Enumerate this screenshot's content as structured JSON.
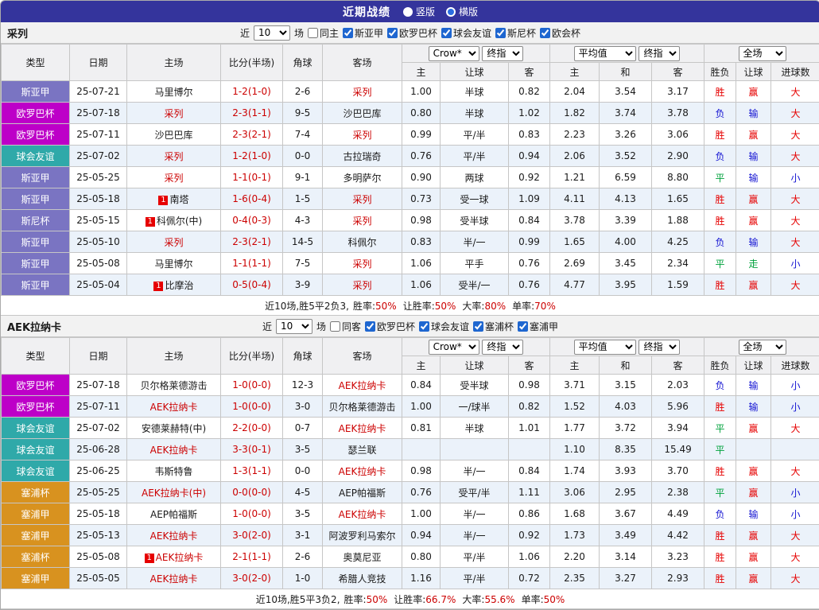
{
  "titlebar": {
    "title": "近期战绩",
    "layout_options": [
      {
        "label": "竖版",
        "selected": false
      },
      {
        "label": "横版",
        "selected": true
      }
    ]
  },
  "table_header": {
    "col_type": "类型",
    "col_date": "日期",
    "col_home": "主场",
    "col_score": "比分(半场)",
    "col_corner": "角球",
    "col_away": "客场",
    "odds_select_company": "Crow*",
    "odds_select_time": "终指",
    "odds_col_home": "主",
    "odds_col_handicap": "让球",
    "odds_col_away": "客",
    "avg_select": "平均值",
    "avg_select_time": "终指",
    "avg_col_home": "主",
    "avg_col_draw": "和",
    "avg_col_away": "客",
    "full_select": "全场",
    "full_col_result": "胜负",
    "full_col_handicap": "让球",
    "full_col_goals": "进球数"
  },
  "league_colors": {
    "斯亚甲": "#7a74c2",
    "欧罗巴杯": "#bd00c8",
    "球会友谊": "#2fa9a9",
    "斯尼杯": "#7a74c2",
    "塞浦杯": "#d8921f",
    "塞浦甲": "#d8921f"
  },
  "result_colors": {
    "胜": "#e60000",
    "负": "#1414d2",
    "平": "#00a23c",
    "赢": "#e60000",
    "输": "#1414d2",
    "走": "#00a23c",
    "大": "#e60000",
    "小": "#1414d2"
  },
  "sections": [
    {
      "team": "采列",
      "filter": {
        "near_label": "近",
        "count": "10",
        "games_label": "场",
        "venue": {
          "label": "同主",
          "checked": false
        },
        "leagues": [
          {
            "label": "斯亚甲",
            "checked": true
          },
          {
            "label": "欧罗巴杯",
            "checked": true
          },
          {
            "label": "球会友谊",
            "checked": true
          },
          {
            "label": "斯尼杯",
            "checked": true
          },
          {
            "label": "欧会杯",
            "checked": true
          }
        ]
      },
      "rows": [
        {
          "league": "斯亚甲",
          "date": "25-07-21",
          "home": {
            "name": "马里博尔",
            "focus": false,
            "badge": ""
          },
          "score": "1-2(1-0)",
          "corner": "2-6",
          "away": {
            "name": "采列",
            "focus": true,
            "badge": ""
          },
          "odds": [
            "1.00",
            "半球",
            "0.82"
          ],
          "avg": [
            "2.04",
            "3.54",
            "3.17"
          ],
          "outcome": [
            "胜",
            "赢",
            "大"
          ]
        },
        {
          "league": "欧罗巴杯",
          "date": "25-07-18",
          "home": {
            "name": "采列",
            "focus": true,
            "badge": ""
          },
          "score": "2-3(1-1)",
          "corner": "9-5",
          "away": {
            "name": "沙巴巴库",
            "focus": false,
            "badge": ""
          },
          "odds": [
            "0.80",
            "半球",
            "1.02"
          ],
          "avg": [
            "1.82",
            "3.74",
            "3.78"
          ],
          "outcome": [
            "负",
            "输",
            "大"
          ]
        },
        {
          "league": "欧罗巴杯",
          "date": "25-07-11",
          "home": {
            "name": "沙巴巴库",
            "focus": false,
            "badge": ""
          },
          "score": "2-3(2-1)",
          "corner": "7-4",
          "away": {
            "name": "采列",
            "focus": true,
            "badge": ""
          },
          "odds": [
            "0.99",
            "平/半",
            "0.83"
          ],
          "avg": [
            "2.23",
            "3.26",
            "3.06"
          ],
          "outcome": [
            "胜",
            "赢",
            "大"
          ]
        },
        {
          "league": "球会友谊",
          "date": "25-07-02",
          "home": {
            "name": "采列",
            "focus": true,
            "badge": ""
          },
          "score": "1-2(1-0)",
          "corner": "0-0",
          "away": {
            "name": "古拉瑞奇",
            "focus": false,
            "badge": ""
          },
          "odds": [
            "0.76",
            "平/半",
            "0.94"
          ],
          "avg": [
            "2.06",
            "3.52",
            "2.90"
          ],
          "outcome": [
            "负",
            "输",
            "大"
          ]
        },
        {
          "league": "斯亚甲",
          "date": "25-05-25",
          "home": {
            "name": "采列",
            "focus": true,
            "badge": ""
          },
          "score": "1-1(0-1)",
          "corner": "9-1",
          "away": {
            "name": "多明萨尔",
            "focus": false,
            "badge": ""
          },
          "odds": [
            "0.90",
            "两球",
            "0.92"
          ],
          "avg": [
            "1.21",
            "6.59",
            "8.80"
          ],
          "outcome": [
            "平",
            "输",
            "小"
          ]
        },
        {
          "league": "斯亚甲",
          "date": "25-05-18",
          "home": {
            "name": "南塔",
            "focus": false,
            "badge": "1"
          },
          "score": "1-6(0-4)",
          "corner": "1-5",
          "away": {
            "name": "采列",
            "focus": true,
            "badge": ""
          },
          "odds": [
            "0.73",
            "受一球",
            "1.09"
          ],
          "avg": [
            "4.11",
            "4.13",
            "1.65"
          ],
          "outcome": [
            "胜",
            "赢",
            "大"
          ]
        },
        {
          "league": "斯尼杯",
          "date": "25-05-15",
          "home": {
            "name": "科佩尔(中)",
            "focus": false,
            "badge": "1"
          },
          "score": "0-4(0-3)",
          "corner": "4-3",
          "away": {
            "name": "采列",
            "focus": true,
            "badge": ""
          },
          "odds": [
            "0.98",
            "受半球",
            "0.84"
          ],
          "avg": [
            "3.78",
            "3.39",
            "1.88"
          ],
          "outcome": [
            "胜",
            "赢",
            "大"
          ]
        },
        {
          "league": "斯亚甲",
          "date": "25-05-10",
          "home": {
            "name": "采列",
            "focus": true,
            "badge": ""
          },
          "score": "2-3(2-1)",
          "corner": "14-5",
          "away": {
            "name": "科佩尔",
            "focus": false,
            "badge": ""
          },
          "odds": [
            "0.83",
            "半/一",
            "0.99"
          ],
          "avg": [
            "1.65",
            "4.00",
            "4.25"
          ],
          "outcome": [
            "负",
            "输",
            "大"
          ]
        },
        {
          "league": "斯亚甲",
          "date": "25-05-08",
          "home": {
            "name": "马里博尔",
            "focus": false,
            "badge": ""
          },
          "score": "1-1(1-1)",
          "corner": "7-5",
          "away": {
            "name": "采列",
            "focus": true,
            "badge": ""
          },
          "odds": [
            "1.06",
            "平手",
            "0.76"
          ],
          "avg": [
            "2.69",
            "3.45",
            "2.34"
          ],
          "outcome": [
            "平",
            "走",
            "小"
          ]
        },
        {
          "league": "斯亚甲",
          "date": "25-05-04",
          "home": {
            "name": "比摩治",
            "focus": false,
            "badge": "1"
          },
          "score": "0-5(0-4)",
          "corner": "3-9",
          "away": {
            "name": "采列",
            "focus": true,
            "badge": ""
          },
          "odds": [
            "1.06",
            "受半/一",
            "0.76"
          ],
          "avg": [
            "4.77",
            "3.95",
            "1.59"
          ],
          "outcome": [
            "胜",
            "赢",
            "大"
          ]
        }
      ],
      "summary": {
        "prefix": "近10场,胜5平2负3,",
        "stats": [
          {
            "label": "胜率:",
            "value": "50%"
          },
          {
            "label": "让胜率:",
            "value": "50%"
          },
          {
            "label": "大率:",
            "value": "80%"
          },
          {
            "label": "单率:",
            "value": "70%"
          }
        ]
      }
    },
    {
      "team": "AEK拉纳卡",
      "filter": {
        "near_label": "近",
        "count": "10",
        "games_label": "场",
        "venue": {
          "label": "同客",
          "checked": false
        },
        "leagues": [
          {
            "label": "欧罗巴杯",
            "checked": true
          },
          {
            "label": "球会友谊",
            "checked": true
          },
          {
            "label": "塞浦杯",
            "checked": true
          },
          {
            "label": "塞浦甲",
            "checked": true
          }
        ]
      },
      "rows": [
        {
          "league": "欧罗巴杯",
          "date": "25-07-18",
          "home": {
            "name": "贝尔格莱德游击",
            "focus": false,
            "badge": ""
          },
          "score": "1-0(0-0)",
          "corner": "12-3",
          "away": {
            "name": "AEK拉纳卡",
            "focus": true,
            "badge": ""
          },
          "odds": [
            "0.84",
            "受半球",
            "0.98"
          ],
          "avg": [
            "3.71",
            "3.15",
            "2.03"
          ],
          "outcome": [
            "负",
            "输",
            "小"
          ]
        },
        {
          "league": "欧罗巴杯",
          "date": "25-07-11",
          "home": {
            "name": "AEK拉纳卡",
            "focus": true,
            "badge": ""
          },
          "score": "1-0(0-0)",
          "corner": "3-0",
          "away": {
            "name": "贝尔格莱德游击",
            "focus": false,
            "badge": ""
          },
          "odds": [
            "1.00",
            "一/球半",
            "0.82"
          ],
          "avg": [
            "1.52",
            "4.03",
            "5.96"
          ],
          "outcome": [
            "胜",
            "输",
            "小"
          ]
        },
        {
          "league": "球会友谊",
          "date": "25-07-02",
          "home": {
            "name": "安德莱赫特(中)",
            "focus": false,
            "badge": ""
          },
          "score": "2-2(0-0)",
          "corner": "0-7",
          "away": {
            "name": "AEK拉纳卡",
            "focus": true,
            "badge": ""
          },
          "odds": [
            "0.81",
            "半球",
            "1.01"
          ],
          "avg": [
            "1.77",
            "3.72",
            "3.94"
          ],
          "outcome": [
            "平",
            "赢",
            "大"
          ]
        },
        {
          "league": "球会友谊",
          "date": "25-06-28",
          "home": {
            "name": "AEK拉纳卡",
            "focus": true,
            "badge": ""
          },
          "score": "3-3(0-1)",
          "corner": "3-5",
          "away": {
            "name": "瑟兰联",
            "focus": false,
            "badge": ""
          },
          "odds": [
            "",
            "",
            ""
          ],
          "avg": [
            "1.10",
            "8.35",
            "15.49"
          ],
          "outcome": [
            "平",
            "",
            ""
          ]
        },
        {
          "league": "球会友谊",
          "date": "25-06-25",
          "home": {
            "name": "韦斯特鲁",
            "focus": false,
            "badge": ""
          },
          "score": "1-3(1-1)",
          "corner": "0-0",
          "away": {
            "name": "AEK拉纳卡",
            "focus": true,
            "badge": ""
          },
          "odds": [
            "0.98",
            "半/一",
            "0.84"
          ],
          "avg": [
            "1.74",
            "3.93",
            "3.70"
          ],
          "outcome": [
            "胜",
            "赢",
            "大"
          ]
        },
        {
          "league": "塞浦杯",
          "date": "25-05-25",
          "home": {
            "name": "AEK拉纳卡(中)",
            "focus": true,
            "badge": ""
          },
          "score": "0-0(0-0)",
          "corner": "4-5",
          "away": {
            "name": "AEP帕福斯",
            "focus": false,
            "badge": ""
          },
          "odds": [
            "0.76",
            "受平/半",
            "1.11"
          ],
          "avg": [
            "3.06",
            "2.95",
            "2.38"
          ],
          "outcome": [
            "平",
            "赢",
            "小"
          ]
        },
        {
          "league": "塞浦甲",
          "date": "25-05-18",
          "home": {
            "name": "AEP帕福斯",
            "focus": false,
            "badge": ""
          },
          "score": "1-0(0-0)",
          "corner": "3-5",
          "away": {
            "name": "AEK拉纳卡",
            "focus": true,
            "badge": ""
          },
          "odds": [
            "1.00",
            "半/一",
            "0.86"
          ],
          "avg": [
            "1.68",
            "3.67",
            "4.49"
          ],
          "outcome": [
            "负",
            "输",
            "小"
          ]
        },
        {
          "league": "塞浦甲",
          "date": "25-05-13",
          "home": {
            "name": "AEK拉纳卡",
            "focus": true,
            "badge": ""
          },
          "score": "3-0(2-0)",
          "corner": "3-1",
          "away": {
            "name": "阿波罗利马索尔",
            "focus": false,
            "badge": ""
          },
          "odds": [
            "0.94",
            "半/一",
            "0.92"
          ],
          "avg": [
            "1.73",
            "3.49",
            "4.42"
          ],
          "outcome": [
            "胜",
            "赢",
            "大"
          ]
        },
        {
          "league": "塞浦杯",
          "date": "25-05-08",
          "home": {
            "name": "AEK拉纳卡",
            "focus": true,
            "badge": "1"
          },
          "score": "2-1(1-1)",
          "corner": "2-6",
          "away": {
            "name": "奥莫尼亚",
            "focus": false,
            "badge": ""
          },
          "odds": [
            "0.80",
            "平/半",
            "1.06"
          ],
          "avg": [
            "2.20",
            "3.14",
            "3.23"
          ],
          "outcome": [
            "胜",
            "赢",
            "大"
          ]
        },
        {
          "league": "塞浦甲",
          "date": "25-05-05",
          "home": {
            "name": "AEK拉纳卡",
            "focus": true,
            "badge": ""
          },
          "score": "3-0(2-0)",
          "corner": "1-0",
          "away": {
            "name": "希腊人竞技",
            "focus": false,
            "badge": ""
          },
          "odds": [
            "1.16",
            "平/半",
            "0.72"
          ],
          "avg": [
            "2.35",
            "3.27",
            "2.93"
          ],
          "outcome": [
            "胜",
            "赢",
            "大"
          ]
        }
      ],
      "summary": {
        "prefix": "近10场,胜5平3负2,",
        "stats": [
          {
            "label": "胜率:",
            "value": "50%"
          },
          {
            "label": "让胜率:",
            "value": "66.7%"
          },
          {
            "label": "大率:",
            "value": "55.6%"
          },
          {
            "label": "单率:",
            "value": "50%"
          }
        ]
      }
    }
  ]
}
